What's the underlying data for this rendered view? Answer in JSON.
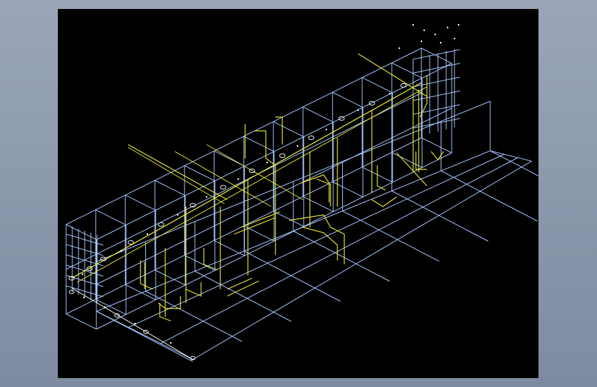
{
  "viewport": {
    "background": "#000000",
    "frame_color": "#a8c8ff",
    "pipe_color": "#e6e632",
    "node_color": "#ffffff"
  }
}
